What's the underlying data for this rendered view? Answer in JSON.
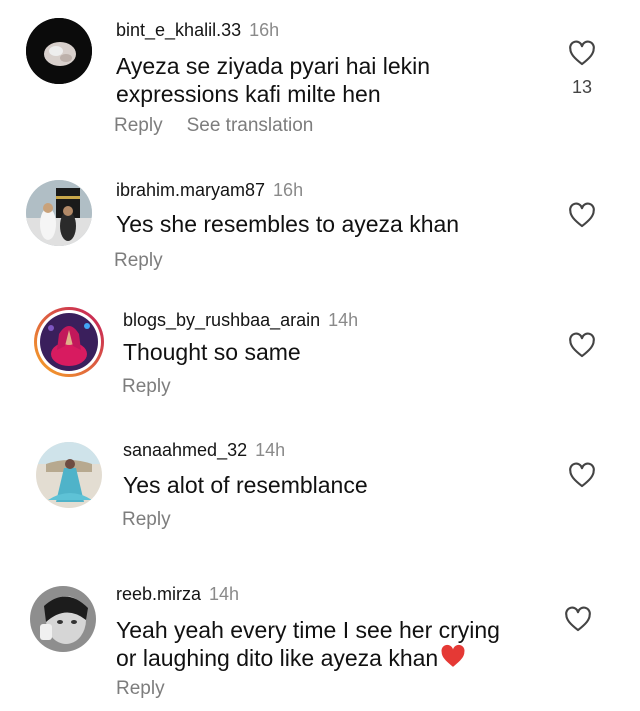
{
  "comments": [
    {
      "username": "bint_e_khalil.33",
      "time": "16h",
      "text_lines": [
        "Ayeza se ziyada pyari hai lekin",
        "expressions kafi milte hen"
      ],
      "reply_label": "Reply",
      "translate_label": "See translation",
      "like_count": "13",
      "like_icon": "heart-outline-icon"
    },
    {
      "username": "ibrahim.maryam87",
      "time": "16h",
      "text_lines": [
        "Yes she resembles to ayeza khan"
      ],
      "reply_label": "Reply",
      "like_icon": "heart-outline-icon"
    },
    {
      "username": "blogs_by_rushbaa_arain",
      "time": "14h",
      "text_lines": [
        "Thought so same"
      ],
      "reply_label": "Reply",
      "like_icon": "heart-outline-icon"
    },
    {
      "username": "sanaahmed_32",
      "time": "14h",
      "text_lines": [
        "Yes alot of resemblance"
      ],
      "reply_label": "Reply",
      "like_icon": "heart-outline-icon"
    },
    {
      "username": "reeb.mirza",
      "time": "14h",
      "text_lines": [
        "Yeah yeah every time I see her crying",
        "or laughing dito like ayeza khan"
      ],
      "emoji": "red-heart-emoji",
      "reply_label": "Reply",
      "like_icon": "heart-outline-icon"
    }
  ],
  "colors": {
    "story_ring_start": "#f9a825",
    "story_ring_end": "#c2185b",
    "heart_emoji": "#e53935"
  }
}
